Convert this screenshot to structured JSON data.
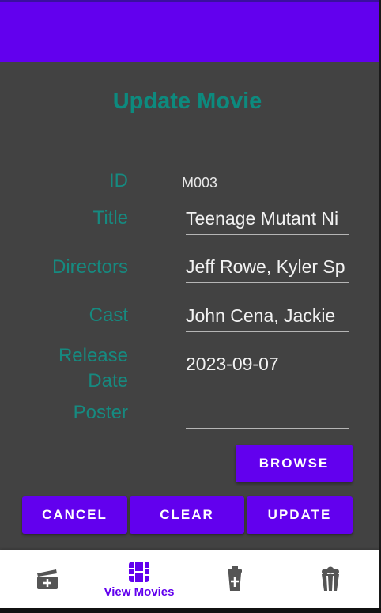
{
  "form": {
    "title": "Update Movie",
    "id_label": "ID",
    "id_value": "M003",
    "title_label": "Title",
    "title_value": "Teenage Mutant Ni",
    "directors_label": "Directors",
    "directors_value": "Jeff Rowe, Kyler Sp",
    "cast_label": "Cast",
    "cast_value": "John Cena, Jackie",
    "release_label_line1": "Release",
    "release_label_line2": "Date",
    "release_value": "2023-09-07",
    "poster_label": "Poster",
    "poster_value": ""
  },
  "buttons": {
    "browse": "BROWSE",
    "cancel": "CANCEL",
    "clear": "CLEAR",
    "update": "UPDATE"
  },
  "bottom_nav": {
    "items": [
      {
        "icon": "add-movie-icon",
        "label": ""
      },
      {
        "icon": "view-movies-icon",
        "label": "View Movies"
      },
      {
        "icon": "delete-cup-icon",
        "label": ""
      },
      {
        "icon": "popcorn-icon",
        "label": ""
      }
    ],
    "active_color": "#6200ee",
    "inactive_color": "#555555"
  },
  "colors": {
    "primary": "#6200ee",
    "accent_text": "#168a80",
    "background": "#424242"
  }
}
